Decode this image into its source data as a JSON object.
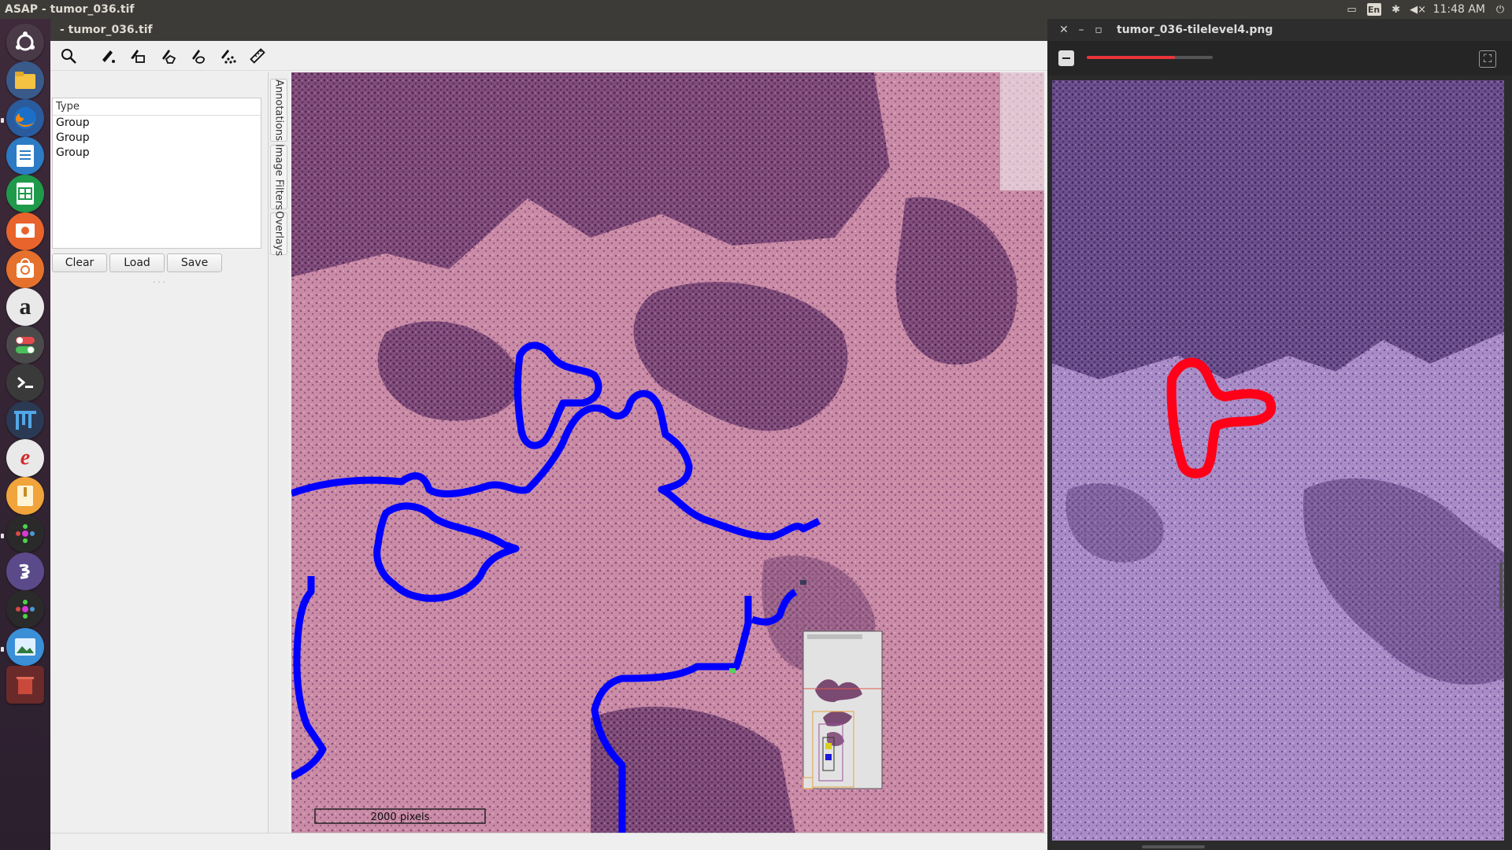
{
  "system": {
    "window_title": "ASAP - tumor_036.tif",
    "clock": "11:48 AM",
    "keyboard_layout": "En",
    "tray_icons": [
      "display-icon",
      "keyboard-layout-icon",
      "bluetooth-icon",
      "volume-muted-icon",
      "power-icon"
    ]
  },
  "launcher": {
    "items": [
      "ubuntu-dash-icon",
      "files-icon",
      "firefox-icon",
      "libreoffice-writer-icon",
      "libreoffice-calc-icon",
      "libreoffice-impress-icon",
      "ubuntu-software-icon",
      "amazon-icon",
      "settings-toggle-icon",
      "terminal-icon",
      "fiji-icon",
      "text-editor-icon",
      "archive-icon",
      "asap-icon",
      "emacs-icon",
      "asap-icon-2",
      "image-viewer-icon",
      "trash-icon"
    ],
    "colors": {
      "top": "#3e2a3a",
      "bottom": "#2b1f2e"
    }
  },
  "asap": {
    "title": "- tumor_036.tif",
    "toolbar": [
      "zoom-tool-icon",
      "dot-annotation-icon",
      "rectangle-annotation-icon",
      "polygon-annotation-icon",
      "spline-annotation-icon",
      "point-set-annotation-icon",
      "measurement-ruler-icon"
    ],
    "annotations": {
      "column_header": "Type",
      "rows": [
        "Group",
        "Group",
        "Group"
      ],
      "buttons": {
        "clear": "Clear",
        "load": "Load",
        "save": "Save"
      }
    },
    "tabs": [
      "Annotations",
      "Image Filters",
      "Overlays"
    ],
    "scale_bar": "2000 pixels",
    "annotation_color": "#0000ff",
    "tissue_color": "#c9869e"
  },
  "image_viewer": {
    "title": "tumor_036-tilelevel4.png",
    "zoom_fraction": 0.7,
    "annotation_color": "#ff0019",
    "tissue_color": "#9b7bb6"
  }
}
